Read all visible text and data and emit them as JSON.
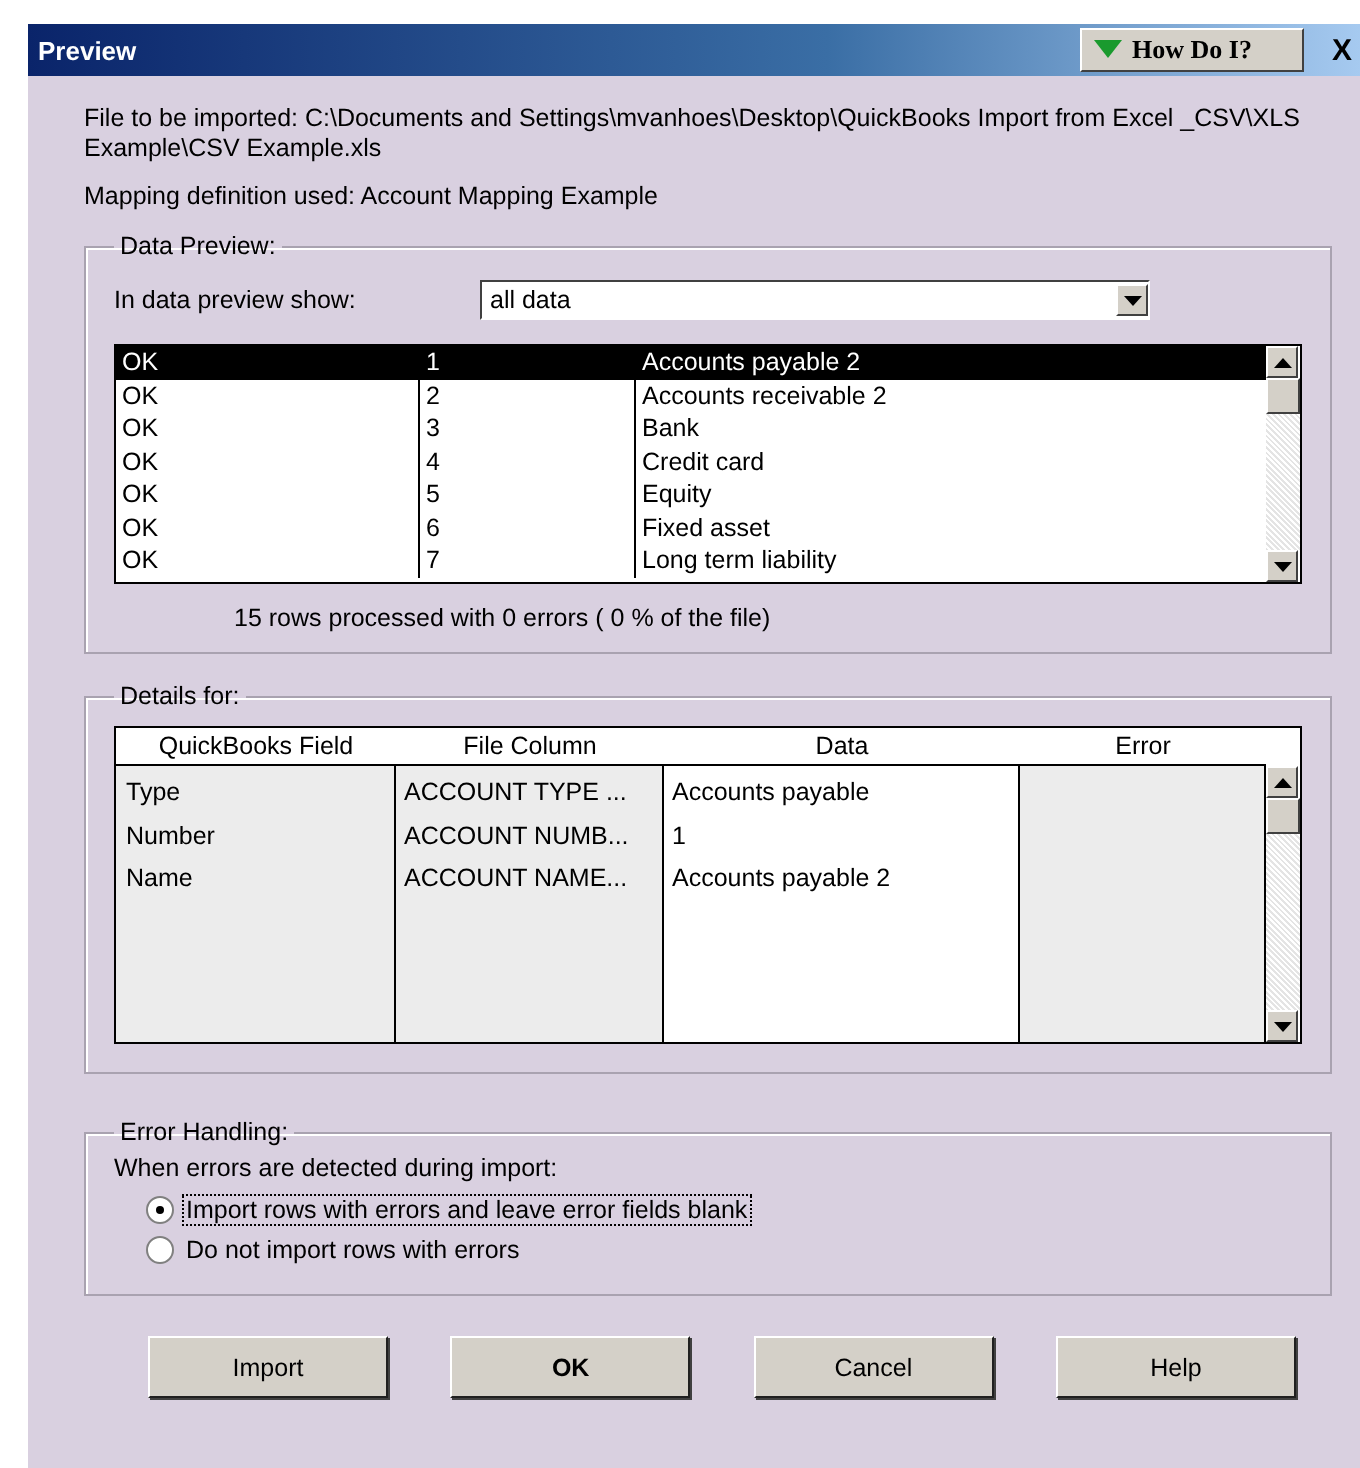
{
  "window": {
    "title": "Preview",
    "help_button": "How Do I?",
    "close": "X"
  },
  "file_line": "File to be imported: C:\\Documents and Settings\\mvanhoes\\Desktop\\QuickBooks Import from Excel _CSV\\XLS Example\\CSV Example.xls",
  "mapping_line": "Mapping definition used: Account Mapping Example",
  "data_preview": {
    "title": "Data Preview:",
    "show_label": "In data preview show:",
    "show_value": "all data",
    "rows": [
      {
        "status": "OK",
        "number": "1",
        "name": "Accounts payable 2",
        "selected": true
      },
      {
        "status": "OK",
        "number": "2",
        "name": "Accounts receivable 2",
        "selected": false
      },
      {
        "status": "OK",
        "number": "3",
        "name": "Bank",
        "selected": false
      },
      {
        "status": "OK",
        "number": "4",
        "name": "Credit card",
        "selected": false
      },
      {
        "status": "OK",
        "number": "5",
        "name": "Equity",
        "selected": false
      },
      {
        "status": "OK",
        "number": "6",
        "name": "Fixed asset",
        "selected": false
      },
      {
        "status": "OK",
        "number": "7",
        "name": "Long term liability",
        "selected": false
      }
    ],
    "summary": "15  rows processed with  0  errors ( 0 % of the file)"
  },
  "details": {
    "title": "Details for:",
    "columns": [
      "QuickBooks Field",
      "File Column",
      "Data",
      "Error"
    ],
    "rows": [
      {
        "field": "Type",
        "file_column": "ACCOUNT TYPE ...",
        "data": "Accounts payable"
      },
      {
        "field": "Number",
        "file_column": "ACCOUNT NUMB...",
        "data": "1"
      },
      {
        "field": "Name",
        "file_column": "ACCOUNT NAME...",
        "data": "Accounts payable 2"
      }
    ]
  },
  "error_handling": {
    "title": "Error Handling:",
    "prompt": "When errors are detected during import:",
    "options": [
      {
        "label": "Import rows with errors and leave error fields blank",
        "selected": true
      },
      {
        "label": "Do not import rows with errors",
        "selected": false
      }
    ]
  },
  "buttons": [
    {
      "label": "Import",
      "default": false
    },
    {
      "label": "OK",
      "default": true
    },
    {
      "label": "Cancel",
      "default": false
    },
    {
      "label": "Help",
      "default": false
    }
  ]
}
